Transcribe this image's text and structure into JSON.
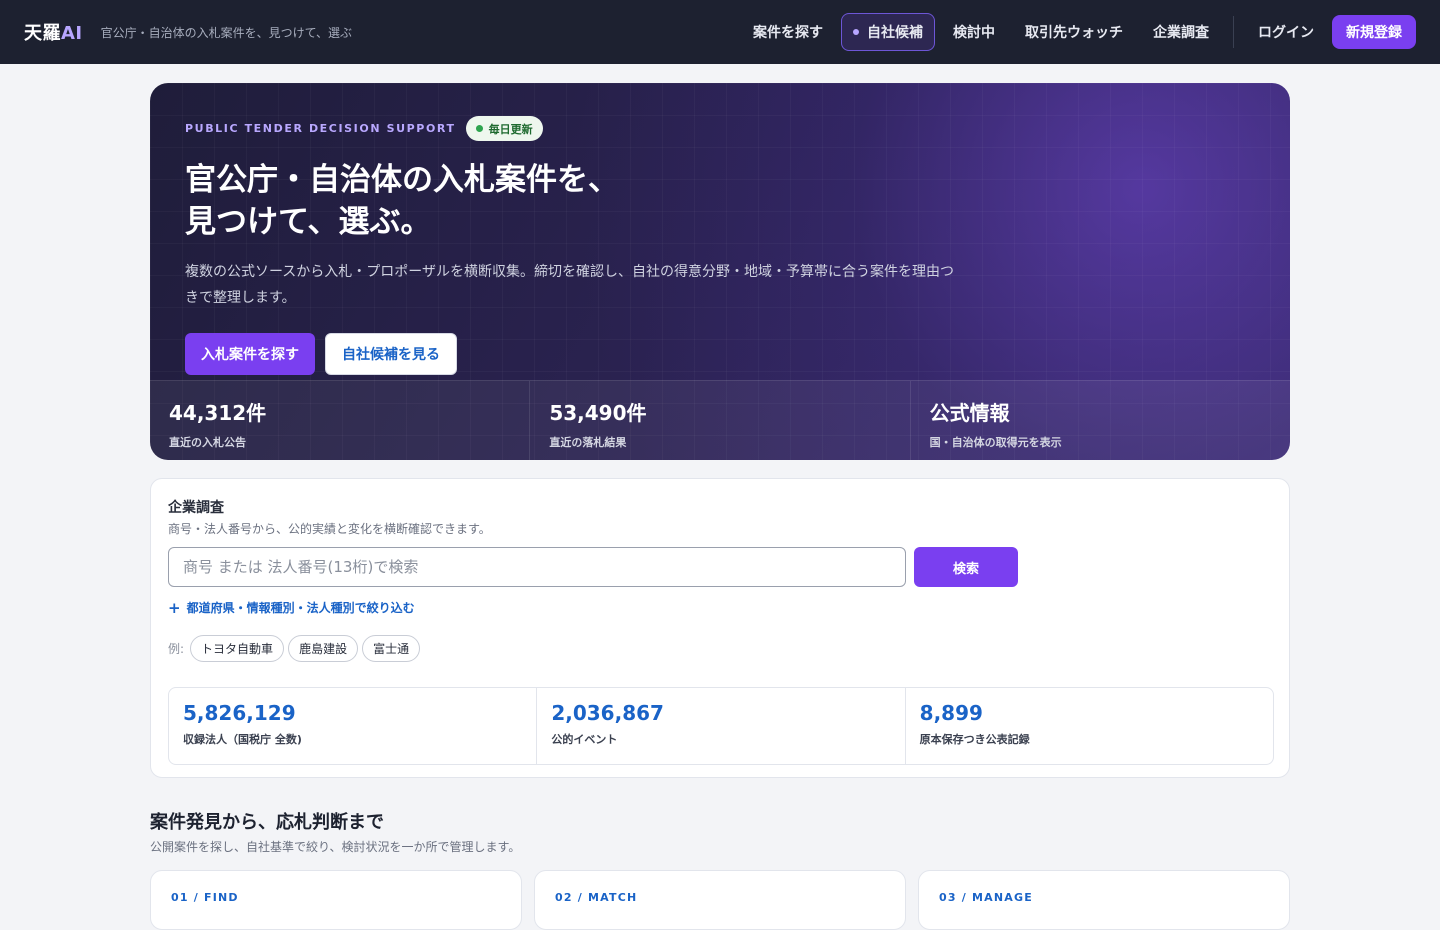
{
  "header": {
    "brand": "天羅",
    "brand_ai": "AI",
    "tagline": "官公庁・自治体の入札案件を、見つけて、選ぶ",
    "nav": [
      {
        "label": "案件を探す"
      },
      {
        "label": "自社候補",
        "active": true
      },
      {
        "label": "検討中"
      },
      {
        "label": "取引先ウォッチ"
      },
      {
        "label": "企業調査"
      }
    ],
    "login": "ログイン",
    "signup": "新規登録"
  },
  "hero": {
    "eyebrow": "PUBLIC TENDER DECISION SUPPORT",
    "badge": "毎日更新",
    "title_line1": "官公庁・自治体の入札案件を、",
    "title_line2": "見つけて、選ぶ。",
    "description": "複数の公式ソースから入札・プロポーザルを横断収集。締切を確認し、自社の得意分野・地域・予算帯に合う案件を理由つきで整理します。",
    "primary_cta": "入札案件を探す",
    "secondary_cta": "自社候補を見る",
    "stats": [
      {
        "value": "44,312件",
        "label": "直近の入札公告"
      },
      {
        "value": "53,490件",
        "label": "直近の落札結果"
      },
      {
        "value": "公式情報",
        "label": "国・自治体の取得元を表示"
      }
    ]
  },
  "company_search": {
    "title": "企業調査",
    "subtitle": "商号・法人番号から、公的実績と変化を横断確認できます。",
    "placeholder": "商号 または 法人番号(13桁)で検索",
    "button": "検索",
    "filter_link": "都道府県・情報種別・法人種別で絞り込む",
    "examples_label": "例:",
    "examples": [
      "トヨタ自動車",
      "鹿島建設",
      "富士通"
    ],
    "stats": [
      {
        "value": "5,826,129",
        "label": "収録法人（国税庁 全数)"
      },
      {
        "value": "2,036,867",
        "label": "公的イベント"
      },
      {
        "value": "8,899",
        "label": "原本保存つき公表記録"
      }
    ]
  },
  "section": {
    "title": "案件発見から、応札判断まで",
    "subtitle": "公開案件を探し、自社基準で絞り、検討状況を一か所で管理します。",
    "features": [
      {
        "tag": "01 / FIND"
      },
      {
        "tag": "02 / MATCH"
      },
      {
        "tag": "03 / MANAGE"
      }
    ]
  },
  "colors": {
    "accent": "#7a3ff0",
    "link": "#1a63c7",
    "header_bg": "#1d2130",
    "status_green": "#2ea44f"
  }
}
